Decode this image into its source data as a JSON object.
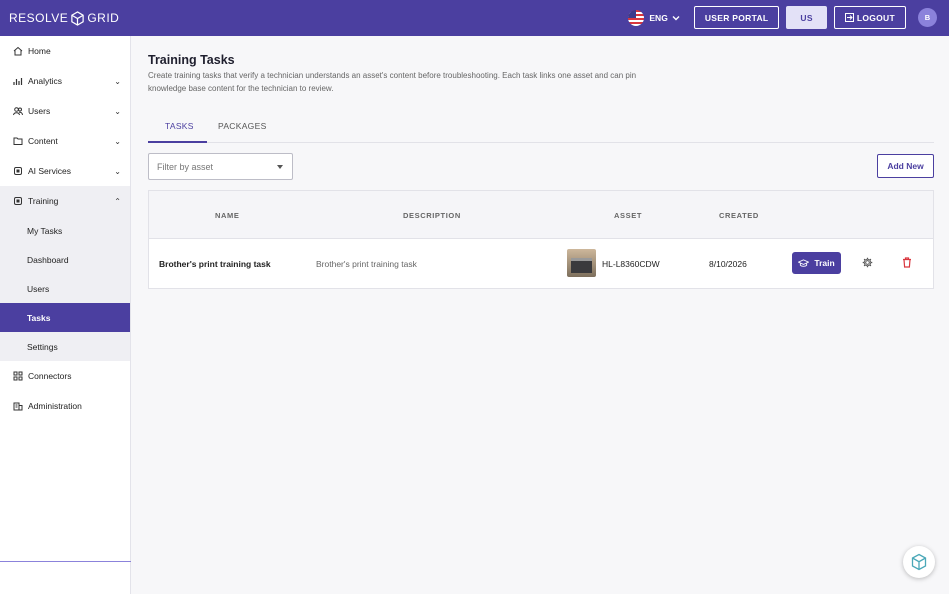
{
  "app": {
    "logo_left": "RESOLVE",
    "logo_right": "GRID"
  },
  "header": {
    "language": "ENG",
    "user_portal": "USER PORTAL",
    "region": "US",
    "logout": "LOGOUT",
    "avatar_initial": "B"
  },
  "sidebar": {
    "items": [
      {
        "label": "Home",
        "icon": "home-icon"
      },
      {
        "label": "Analytics",
        "icon": "analytics-icon"
      },
      {
        "label": "Users",
        "icon": "users-icon"
      },
      {
        "label": "Content",
        "icon": "folder-icon"
      },
      {
        "label": "AI Services",
        "icon": "ai-icon"
      },
      {
        "label": "Training",
        "icon": "training-icon"
      },
      {
        "label": "Connectors",
        "icon": "grid-icon"
      },
      {
        "label": "Administration",
        "icon": "building-icon"
      }
    ],
    "training_subitems": [
      "My Tasks",
      "Dashboard",
      "Users",
      "Tasks",
      "Settings"
    ],
    "active_subitem": "Tasks"
  },
  "main": {
    "title": "Training Tasks",
    "description": "Create training tasks that verify a technician understands an asset's content before troubleshooting. Each task links one asset and can pin knowledge base content for the technician to review.",
    "tabs": [
      {
        "label": "TASKS"
      },
      {
        "label": "PACKAGES"
      }
    ],
    "active_tab": "TASKS",
    "filter_placeholder": "Filter by asset",
    "add_new": "Add New",
    "table": {
      "columns": [
        "NAME",
        "DESCRIPTION",
        "ASSET",
        "CREATED"
      ],
      "rows": [
        {
          "name": "Brother's print training task",
          "description": "Brother's print training task",
          "asset": "HL-L8360CDW",
          "created": "8/10/2026",
          "action": "Train"
        }
      ]
    }
  },
  "colors": {
    "brand": "#4b3fa0",
    "delete": "#d9363e"
  }
}
